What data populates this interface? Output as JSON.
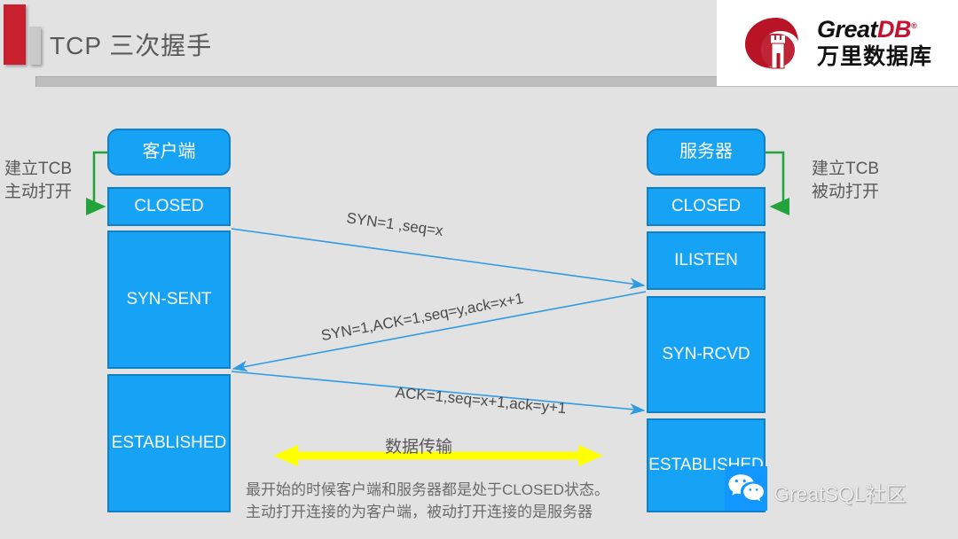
{
  "slide": {
    "title": "TCP  三次握手",
    "background_color": "#e2e2e2",
    "accent_color": "#c8202f"
  },
  "logo": {
    "name": "greatdb-logo",
    "word_great": "Great",
    "word_db": "DB",
    "trademark": "®",
    "chinese": "万里数据库",
    "brand_red": "#c41230"
  },
  "diagram": {
    "node_color": "#17a3f5",
    "node_border_color": "#1280c4",
    "arrow_color": "#2f9be3",
    "green_color": "#22a33b",
    "highlight_color": "#ffff00",
    "client": {
      "header": "客户端",
      "states": [
        "CLOSED",
        "SYN-SENT",
        "ESTABLISHED"
      ]
    },
    "server": {
      "header": "服务器",
      "states": [
        "CLOSED",
        "ILISTEN",
        "SYN-RCVD",
        "ESTABLISHED"
      ]
    },
    "left_note": "建立TCB\n主动打开",
    "right_note": "建立TCB\n被动打开",
    "messages": [
      {
        "label": "SYN=1 ,seq=x",
        "direction": "client-to-server"
      },
      {
        "label": "SYN=1,ACK=1,seq=y,ack=x+1",
        "direction": "server-to-client"
      },
      {
        "label": "ACK=1,seq=x+1,ack=y+1",
        "direction": "client-to-server"
      }
    ],
    "data_transfer_label": "数据传输",
    "footnote": "最开始的时候客户端和服务器都是处于CLOSED状态。\n主动打开连接的为客户端，被动打开连接的是服务器"
  },
  "watermark": {
    "icon": "wechat-icon",
    "text": "GreatSQL社区"
  }
}
